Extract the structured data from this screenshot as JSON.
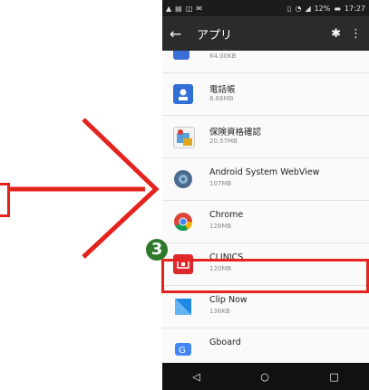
{
  "statusbar": {
    "battery": "12%",
    "time": "17:27"
  },
  "appbar": {
    "back_icon": "←",
    "title": "アプリ",
    "settings_icon": "gear-icon",
    "more_icon": "⋮"
  },
  "apps": [
    {
      "name": "",
      "size": "64.00KB"
    },
    {
      "name": "電話帳",
      "size": "8.66MB"
    },
    {
      "name": "保険資格確認",
      "size": "20.57MB"
    },
    {
      "name": "Android System WebView",
      "size": "107MB"
    },
    {
      "name": "Chrome",
      "size": "128MB"
    },
    {
      "name": "CLINICS",
      "size": "120MB"
    },
    {
      "name": "Clip Now",
      "size": "136KB"
    },
    {
      "name": "Gboard",
      "size": ""
    }
  ],
  "annotation": {
    "step_number": "3",
    "accent_color": "#e4231f"
  },
  "navbar": {
    "back": "◁",
    "home": "○",
    "recents": "□"
  }
}
